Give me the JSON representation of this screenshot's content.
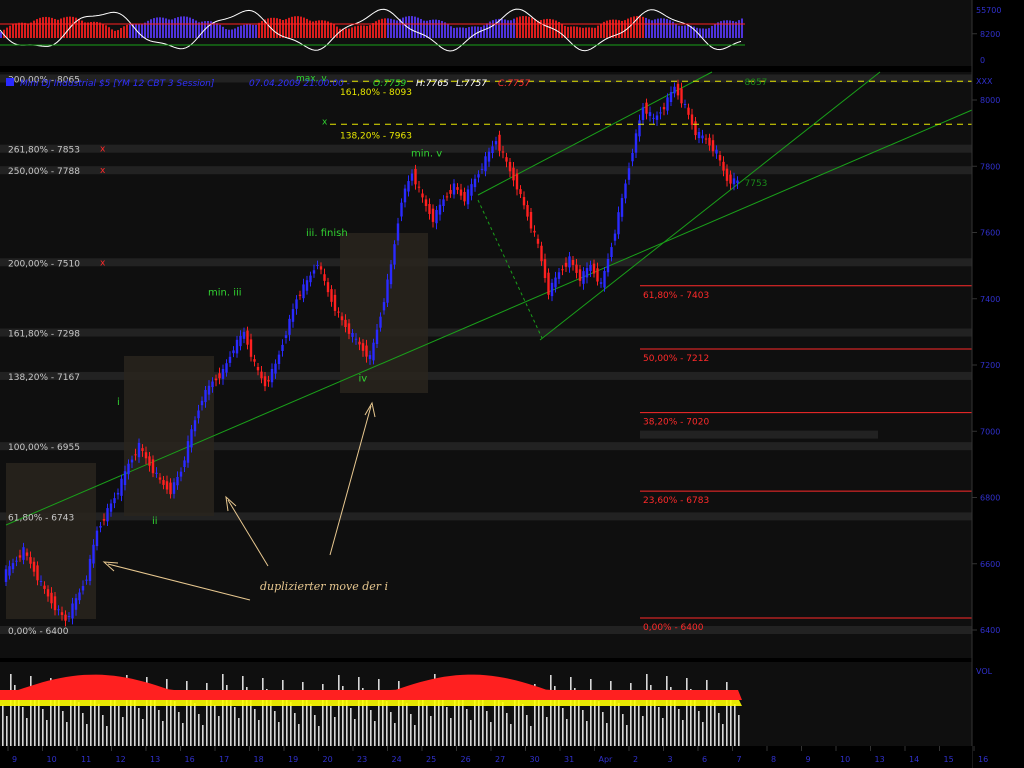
{
  "colors": {
    "background": "#000000",
    "panel": "#0f0f0f",
    "up_bar": "#2a2aff",
    "down_bar": "#ff2020",
    "fib_level": "#c8c8c8",
    "fib_retrace": "#ff2a2a",
    "fib_ext": "#e8e800",
    "wave_label": "#31d231",
    "note": "#e8c890",
    "channel": "#1aa01a",
    "axis_text": "#3030cc",
    "highlight_band": "#2a2a2a"
  },
  "chart_data": {
    "type": "candlestick",
    "title": {
      "symbol": "Mini DJ Industrial $5 [YM 12 CBT  3 Session]",
      "datetime": "07.04.2009 21:00:00 -",
      "open": "O:7759",
      "high": "H:7765",
      "low": "L:7757",
      "close": "C:7757"
    },
    "ylim": [
      6400,
      8200
    ],
    "y_ticks": [
      "8200",
      "8000",
      "7800",
      "7600",
      "7400",
      "7200",
      "7000",
      "6800",
      "6600",
      "6400"
    ],
    "x_ticks": [
      "9",
      "10",
      "11",
      "12",
      "13",
      "16",
      "17",
      "18",
      "19",
      "20",
      "23",
      "24",
      "25",
      "26",
      "27",
      "30",
      "31",
      "Apr",
      "2",
      "3",
      "6",
      "7",
      "8",
      "9",
      "10",
      "13",
      "14",
      "15",
      "16"
    ],
    "top_panel_ticks": [
      "55700",
      "0"
    ],
    "bottom_panel_label": "VOL",
    "right_axis_label": "XXX",
    "price_series": [
      {
        "x": 0,
        "y": 6560
      },
      {
        "x": 3,
        "y": 6600
      },
      {
        "x": 6,
        "y": 6640
      },
      {
        "x": 9,
        "y": 6580
      },
      {
        "x": 12,
        "y": 6520
      },
      {
        "x": 15,
        "y": 6470
      },
      {
        "x": 18,
        "y": 6430
      },
      {
        "x": 21,
        "y": 6490
      },
      {
        "x": 24,
        "y": 6560
      },
      {
        "x": 27,
        "y": 6700
      },
      {
        "x": 30,
        "y": 6760
      },
      {
        "x": 33,
        "y": 6820
      },
      {
        "x": 36,
        "y": 6900
      },
      {
        "x": 39,
        "y": 6955
      },
      {
        "x": 42,
        "y": 6900
      },
      {
        "x": 45,
        "y": 6850
      },
      {
        "x": 48,
        "y": 6820
      },
      {
        "x": 51,
        "y": 6880
      },
      {
        "x": 54,
        "y": 7000
      },
      {
        "x": 57,
        "y": 7100
      },
      {
        "x": 60,
        "y": 7150
      },
      {
        "x": 63,
        "y": 7180
      },
      {
        "x": 66,
        "y": 7250
      },
      {
        "x": 69,
        "y": 7298
      },
      {
        "x": 72,
        "y": 7200
      },
      {
        "x": 75,
        "y": 7140
      },
      {
        "x": 78,
        "y": 7200
      },
      {
        "x": 81,
        "y": 7300
      },
      {
        "x": 84,
        "y": 7400
      },
      {
        "x": 87,
        "y": 7450
      },
      {
        "x": 90,
        "y": 7510
      },
      {
        "x": 93,
        "y": 7420
      },
      {
        "x": 96,
        "y": 7350
      },
      {
        "x": 99,
        "y": 7300
      },
      {
        "x": 102,
        "y": 7260
      },
      {
        "x": 105,
        "y": 7220
      },
      {
        "x": 108,
        "y": 7350
      },
      {
        "x": 111,
        "y": 7500
      },
      {
        "x": 114,
        "y": 7700
      },
      {
        "x": 117,
        "y": 7780
      },
      {
        "x": 120,
        "y": 7700
      },
      {
        "x": 123,
        "y": 7640
      },
      {
        "x": 126,
        "y": 7700
      },
      {
        "x": 129,
        "y": 7740
      },
      {
        "x": 132,
        "y": 7700
      },
      {
        "x": 135,
        "y": 7760
      },
      {
        "x": 138,
        "y": 7820
      },
      {
        "x": 141,
        "y": 7880
      },
      {
        "x": 144,
        "y": 7810
      },
      {
        "x": 147,
        "y": 7740
      },
      {
        "x": 150,
        "y": 7650
      },
      {
        "x": 153,
        "y": 7560
      },
      {
        "x": 156,
        "y": 7420
      },
      {
        "x": 159,
        "y": 7480
      },
      {
        "x": 162,
        "y": 7520
      },
      {
        "x": 165,
        "y": 7460
      },
      {
        "x": 168,
        "y": 7500
      },
      {
        "x": 171,
        "y": 7440
      },
      {
        "x": 174,
        "y": 7560
      },
      {
        "x": 177,
        "y": 7700
      },
      {
        "x": 180,
        "y": 7850
      },
      {
        "x": 183,
        "y": 7980
      },
      {
        "x": 186,
        "y": 7940
      },
      {
        "x": 189,
        "y": 7980
      },
      {
        "x": 192,
        "y": 8040
      },
      {
        "x": 195,
        "y": 7980
      },
      {
        "x": 198,
        "y": 7900
      },
      {
        "x": 201,
        "y": 7880
      },
      {
        "x": 204,
        "y": 7840
      },
      {
        "x": 207,
        "y": 7760
      },
      {
        "x": 210,
        "y": 7753
      }
    ],
    "fib_levels_left": [
      {
        "label": "300,00% - 8065",
        "price": 8065,
        "marker": ""
      },
      {
        "label": "261,80% - 7853",
        "price": 7853,
        "marker": "x"
      },
      {
        "label": "250,00% - 7788",
        "price": 7788,
        "marker": "x"
      },
      {
        "label": "200,00% - 7510",
        "price": 7510,
        "marker": "x"
      },
      {
        "label": "161,80% - 7298",
        "price": 7298,
        "marker": ""
      },
      {
        "label": "138,20% - 7167",
        "price": 7167,
        "marker": ""
      },
      {
        "label": "100,00% - 6955",
        "price": 6955,
        "marker": ""
      },
      {
        "label": "61,80% - 6743",
        "price": 6743,
        "marker": ""
      },
      {
        "label": "0,00% - 6400",
        "price": 6400,
        "marker": ""
      }
    ],
    "fib_levels_right": [
      {
        "label": "61,80% - 7403",
        "price": 7403
      },
      {
        "label": "50,00% - 7212",
        "price": 7212
      },
      {
        "label": "38,20% - 7020",
        "price": 7020
      },
      {
        "label": "23,60% - 6783",
        "price": 6783
      },
      {
        "label": "0,00% - 6400",
        "price": 6400
      }
    ],
    "fib_extensions": [
      {
        "label": "161,80% - 8093",
        "price": 8093,
        "marker": "max. v"
      },
      {
        "label": "138,20% - 7963",
        "price": 7963,
        "marker": "x"
      }
    ],
    "wave_labels": [
      {
        "text": "i",
        "x": 34,
        "price": 7080
      },
      {
        "text": "ii",
        "x": 44,
        "price": 6720
      },
      {
        "text": "min. iii",
        "x": 60,
        "price": 7410
      },
      {
        "text": "iii. finish",
        "x": 88,
        "price": 7590
      },
      {
        "text": "iv",
        "x": 103,
        "price": 7150
      },
      {
        "text": "min. v",
        "x": 118,
        "price": 7830
      }
    ],
    "price_tags": [
      {
        "text": "8057",
        "x": 211,
        "price": 8057
      },
      {
        "text": "7753",
        "x": 211,
        "price": 7753
      }
    ],
    "annotation": "duplizierter move der i"
  }
}
